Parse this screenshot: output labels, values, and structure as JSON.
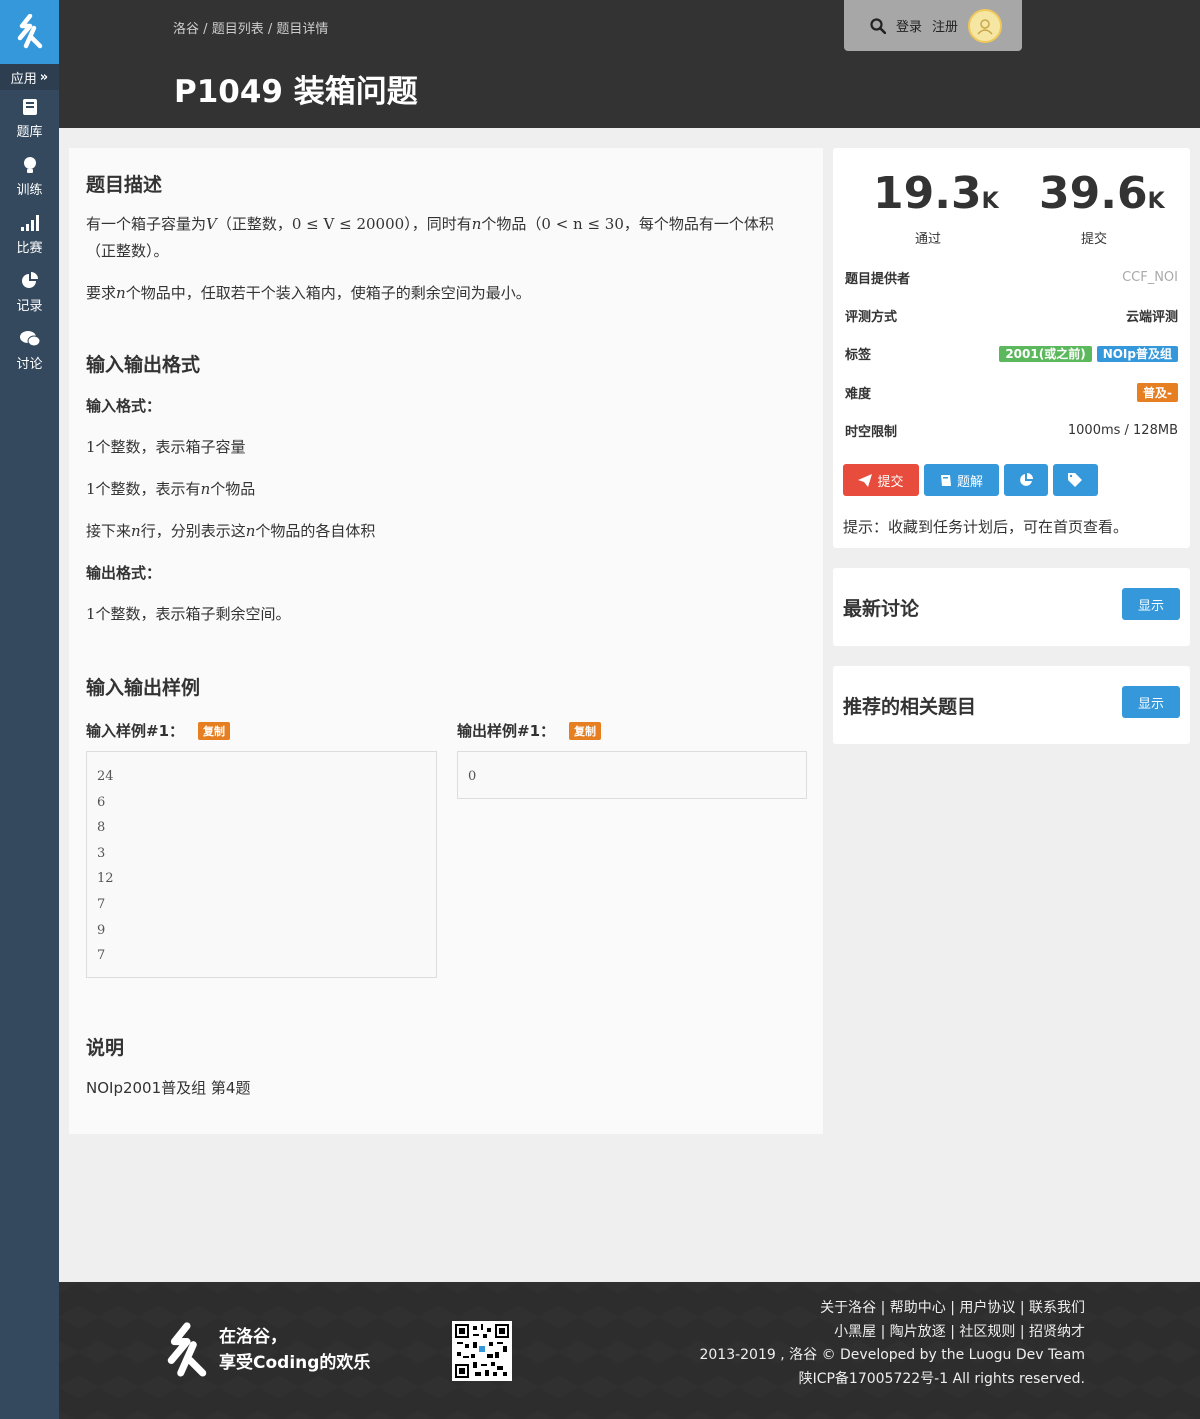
{
  "sidebar": {
    "app_label": "应用",
    "items": [
      {
        "label": "题库",
        "icon": "book-icon"
      },
      {
        "label": "训练",
        "icon": "bulb-icon"
      },
      {
        "label": "比赛",
        "icon": "signal-icon"
      },
      {
        "label": "记录",
        "icon": "pie-chart-icon"
      },
      {
        "label": "讨论",
        "icon": "comments-icon"
      }
    ]
  },
  "header": {
    "breadcrumb": [
      "洛谷",
      "题目列表",
      "题目详情"
    ],
    "separator": "/",
    "title": "P1049 装箱问题",
    "login": "登录",
    "register": "注册"
  },
  "problem": {
    "desc_heading": "题目描述",
    "desc_p1": {
      "t1": "有一个箱子容量为",
      "v": "V",
      "t2": "（正整数，",
      "ineq": "0 ≤ V ≤ 20000",
      "t3": "），同时有",
      "n": "n",
      "t4": "个物品（",
      "ineq2": "0 < n ≤ 30",
      "t5": "，每个物品有一个体积（正整数）。"
    },
    "desc_p2": {
      "t1": "要求",
      "n": "n",
      "t2": "个物品中，任取若干个装入箱内，使箱子的剩余空间为最小。"
    },
    "io_heading": "输入输出格式",
    "input_format_label": "输入格式：",
    "input_line1": {
      "num": "1",
      "text": "个整数，表示箱子容量"
    },
    "input_line2": {
      "num": "1",
      "t1": "个整数，表示有",
      "n": "n",
      "t2": "个物品"
    },
    "input_line3": {
      "t1": "接下来",
      "n": "n",
      "t2": "行，分别表示这",
      "n2": "n",
      "t3": "个物品的各自体积"
    },
    "output_format_label": "输出格式：",
    "output_line1": {
      "num": "1",
      "text": "个整数，表示箱子剩余空间。"
    },
    "sample_heading": "输入输出样例",
    "input_sample_label": "输入样例#1：",
    "output_sample_label": "输出样例#1：",
    "copy_label": "复制",
    "input_sample": [
      "24",
      "6",
      "8",
      "3",
      "12",
      "7",
      "9",
      "7"
    ],
    "output_sample": [
      "0"
    ],
    "note_heading": "说明",
    "note_text": "NOIp2001普及组 第4题"
  },
  "stats": {
    "passed": {
      "value": "19.3",
      "unit": "K",
      "label": "通过"
    },
    "submitted": {
      "value": "39.6",
      "unit": "K",
      "label": "提交"
    }
  },
  "info": {
    "provider_key": "题目提供者",
    "provider_val": "CCF_NOI",
    "judge_key": "评测方式",
    "judge_val": "云端评测",
    "tags_key": "标签",
    "tags": [
      {
        "label": "2001(或之前)",
        "color": "#5cb85c"
      },
      {
        "label": "NOIp普及组",
        "color": "#3498db"
      }
    ],
    "difficulty_key": "难度",
    "difficulty_val": "普及-",
    "difficulty_color": "#e67e22",
    "limit_key": "时空限制",
    "limit_val": "1000ms / 128MB"
  },
  "actions": {
    "submit": "提交",
    "solution": "题解"
  },
  "hint": "提示：收藏到任务计划后，可在首页查看。",
  "discussion": {
    "title": "最新讨论",
    "button": "显示"
  },
  "related": {
    "title": "推荐的相关题目",
    "button": "显示"
  },
  "footer": {
    "slogan1": "在洛谷，",
    "slogan2": "享受Coding的欢乐",
    "links1": [
      "关于洛谷",
      "帮助中心",
      "用户协议",
      "联系我们"
    ],
    "links2": [
      "小黑屋",
      "陶片放逐",
      "社区规则",
      "招贤纳才"
    ],
    "copyright": "2013-2019 , 洛谷 © Developed by the Luogu Dev Team",
    "icp": "陕ICP备17005722号-1 All rights reserved."
  },
  "colors": {
    "brand": "#3498db",
    "danger": "#e74c3c",
    "sidebar": "#34495e",
    "header": "#333333"
  }
}
